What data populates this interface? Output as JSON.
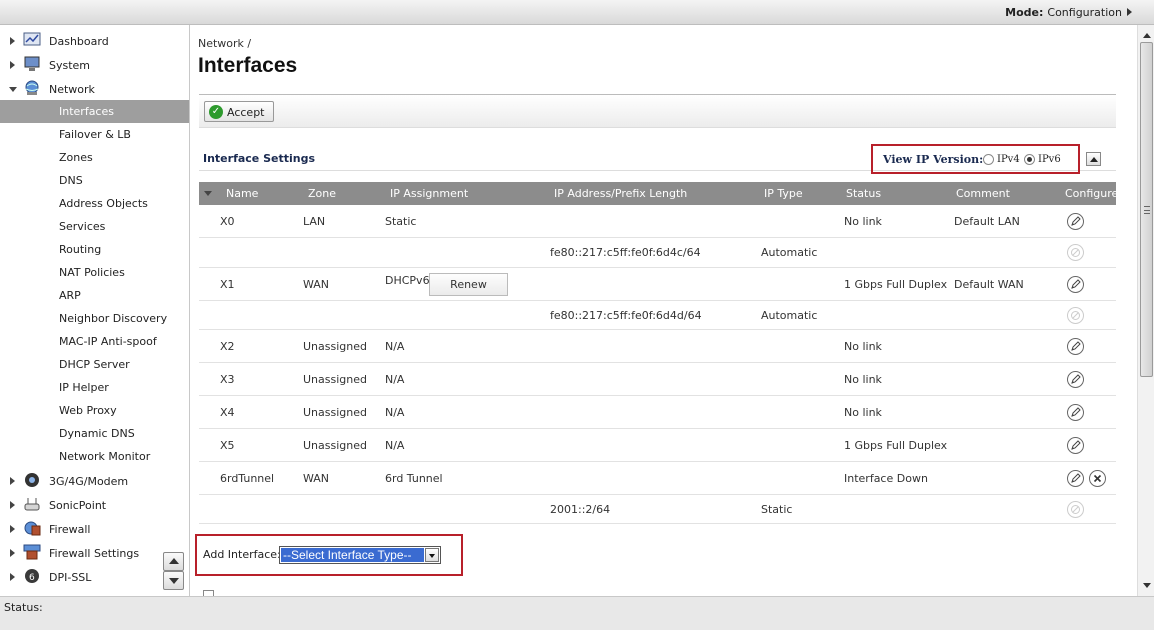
{
  "topbar": {
    "mode_label": "Mode:",
    "mode_value": "Configuration"
  },
  "sidebar": {
    "top_items": [
      {
        "label": "Dashboard",
        "icon": "dashboard-icon"
      },
      {
        "label": "System",
        "icon": "system-icon"
      },
      {
        "label": "Network",
        "icon": "network-icon",
        "expanded": true
      }
    ],
    "sub_items": [
      "Interfaces",
      "Failover & LB",
      "Zones",
      "DNS",
      "Address Objects",
      "Services",
      "Routing",
      "NAT Policies",
      "ARP",
      "Neighbor Discovery",
      "MAC-IP Anti-spoof",
      "DHCP Server",
      "IP Helper",
      "Web Proxy",
      "Dynamic DNS",
      "Network Monitor"
    ],
    "active_sub_item": "Interfaces",
    "bottom_items": [
      {
        "label": "3G/4G/Modem",
        "icon": "modem-icon"
      },
      {
        "label": "SonicPoint",
        "icon": "sonicpoint-icon"
      },
      {
        "label": "Firewall",
        "icon": "firewall-icon"
      },
      {
        "label": "Firewall Settings",
        "icon": "firewall-settings-icon"
      },
      {
        "label": "DPI-SSL",
        "icon": "dpi-ssl-icon"
      }
    ]
  },
  "page": {
    "breadcrumb": "Network /",
    "title": "Interfaces",
    "accept_label": "Accept",
    "section_title": "Interface Settings",
    "ip_version": {
      "label": "View IP Version:",
      "options": [
        "IPv4",
        "IPv6"
      ],
      "selected": "IPv6"
    }
  },
  "table": {
    "columns": [
      "Name",
      "Zone",
      "IP Assignment",
      "IP Address/Prefix Length",
      "IP Type",
      "Status",
      "Comment",
      "Configure"
    ],
    "rows": [
      {
        "name": "X0",
        "zone": "LAN",
        "assignment": "Static",
        "address": "",
        "type": "",
        "status": "No link",
        "comment": "Default LAN"
      },
      {
        "name": "",
        "zone": "",
        "assignment": "",
        "address": "fe80::217:c5ff:fe0f:6d4c/64",
        "type": "Automatic",
        "status": "",
        "comment": ""
      },
      {
        "name": "X1",
        "zone": "WAN",
        "assignment": "DHCPv6",
        "renew_label": "Renew",
        "address": "",
        "type": "",
        "status": "1 Gbps Full Duplex",
        "comment": "Default WAN"
      },
      {
        "name": "",
        "zone": "",
        "assignment": "",
        "address": "fe80::217:c5ff:fe0f:6d4d/64",
        "type": "Automatic",
        "status": "",
        "comment": ""
      },
      {
        "name": "X2",
        "zone": "Unassigned",
        "assignment": "N/A",
        "address": "",
        "type": "",
        "status": "No link",
        "comment": ""
      },
      {
        "name": "X3",
        "zone": "Unassigned",
        "assignment": "N/A",
        "address": "",
        "type": "",
        "status": "No link",
        "comment": ""
      },
      {
        "name": "X4",
        "zone": "Unassigned",
        "assignment": "N/A",
        "address": "",
        "type": "",
        "status": "No link",
        "comment": ""
      },
      {
        "name": "X5",
        "zone": "Unassigned",
        "assignment": "N/A",
        "address": "",
        "type": "",
        "status": "1 Gbps Full Duplex",
        "comment": ""
      },
      {
        "name": "6rdTunnel",
        "zone": "WAN",
        "assignment": "6rd Tunnel",
        "address": "",
        "type": "",
        "status": "Interface Down",
        "comment": ""
      },
      {
        "name": "",
        "zone": "",
        "assignment": "",
        "address": "2001::2/64",
        "type": "Static",
        "status": "",
        "comment": ""
      }
    ]
  },
  "add_interface": {
    "label": "Add Interface:",
    "select_value": "--Select Interface Type--"
  },
  "statusbar": {
    "label": "Status:"
  },
  "colors": {
    "highlight_box": "#b8202a",
    "table_header": "#8c8c8c",
    "active_nav": "#9e9e9e",
    "select_highlight": "#3a6bd1"
  }
}
